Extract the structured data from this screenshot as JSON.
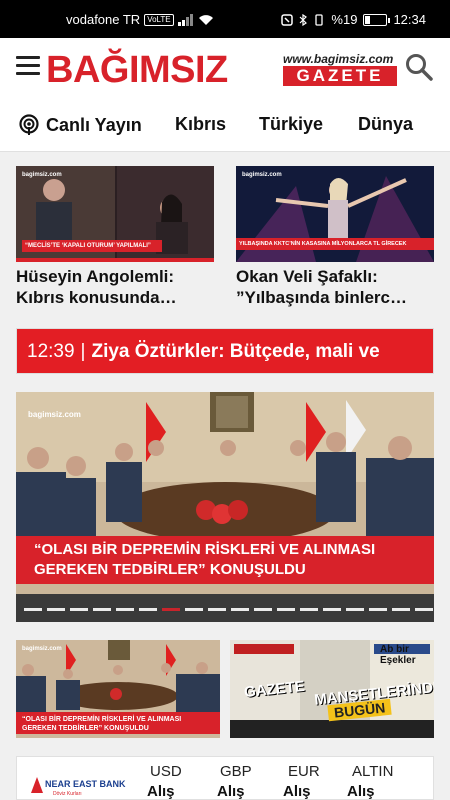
{
  "status_bar": {
    "carrier": "vodafone TR",
    "volte": "VoLTE",
    "battery": "%19",
    "time": "12:34"
  },
  "header": {
    "logo_main": "BAĞIMSIZ",
    "logo_url": "www.bagimsiz.com",
    "logo_gazete": "GAZETE"
  },
  "nav": {
    "live": "Canlı Yayın",
    "items": [
      "Kıbrıs",
      "Türkiye",
      "Dünya"
    ]
  },
  "cards": [
    {
      "title_line1": "Hüseyin Angolemli:",
      "title_line2": "Kıbrıs konusunda…",
      "overlay": "“MECLİS’TE ‘KAPALI OTURUM’ YAPILMALI”",
      "site": "bagimsiz.com"
    },
    {
      "title_line1": "Okan Veli Şafaklı:",
      "title_line2": "”Yılbaşında binlerc…",
      "overlay": "YILBAŞINDA KKTC’NİN KASASINA MİLYONLARCA TL GİRECEK",
      "site": "bagimsiz.com"
    }
  ],
  "ticker": {
    "time": "12:39",
    "separator": "|",
    "text": "Ziya Öztürkler: Bütçede, mali ve"
  },
  "hero": {
    "site": "bagimsiz.com",
    "caption_line1": "“OLASI BİR DEPREMİN RİSKLERİ VE ALINMASI",
    "caption_line2": "GEREKEN TEDBİRLER” KONUŞULDU",
    "dot_count": 18,
    "active_dot": 6
  },
  "small_cards": [
    {
      "site": "bagimsiz.com",
      "caption_line1": "“OLASI BİR DEPREMİN RİSKLERİ VE ALINMASI",
      "caption_line2": "GEREKEN TEDBİRLER” KONUŞULDU"
    },
    {
      "title_line1": "GAZETE",
      "title_line2": "MANŞETLERİNDE",
      "title_line3": "BUGÜN",
      "paper_text": "Ab bir Eşekler"
    }
  ],
  "currency": {
    "bank": "NEAR EAST BANK",
    "bank_sub": "Döviz Kurları",
    "headers": [
      "USD",
      "GBP",
      "EUR",
      "ALTIN"
    ],
    "values": [
      "Alış",
      "Alış",
      "Alış",
      "Alış"
    ]
  },
  "colors": {
    "brand_red": "#d8222a",
    "ticker_red": "#e31e24"
  }
}
